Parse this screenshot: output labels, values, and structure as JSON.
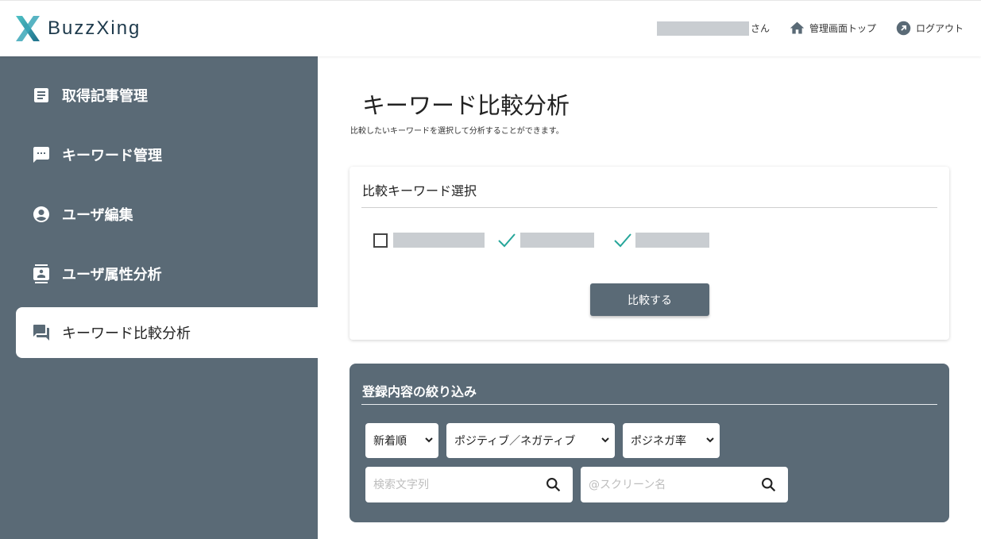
{
  "header": {
    "logo_text": "BuzzXing",
    "user_suffix": "さん",
    "admin_top_label": "管理画面トップ",
    "logout_label": "ログアウト"
  },
  "sidebar": {
    "items": [
      {
        "label": "取得記事管理",
        "icon": "article-icon"
      },
      {
        "label": "キーワード管理",
        "icon": "chat-bubble-icon"
      },
      {
        "label": "ユーザ編集",
        "icon": "account-circle-icon"
      },
      {
        "label": "ユーザ属性分析",
        "icon": "contact-card-icon"
      },
      {
        "label": "キーワード比較分析",
        "icon": "forum-icon",
        "active": true
      }
    ]
  },
  "main": {
    "title": "キーワード比較分析",
    "subtitle": "比較したいキーワードを選択して分析することができます。",
    "keyword_card": {
      "title": "比較キーワード選択",
      "keywords": [
        {
          "checked": false
        },
        {
          "checked": true
        },
        {
          "checked": true
        }
      ],
      "compare_button": "比較する"
    },
    "filter": {
      "title": "登録内容の絞り込み",
      "sort_select": "新着順",
      "sentiment_select": "ポジティブ／ネガティブ",
      "ratio_select": "ポジネガ率",
      "search_placeholder": "検索文字列",
      "screen_name_placeholder": "@スクリーン名"
    }
  },
  "colors": {
    "sidebar_bg": "#5a6a76",
    "accent_teal": "#26a69a",
    "placeholder_gray": "#c9cdd1"
  }
}
